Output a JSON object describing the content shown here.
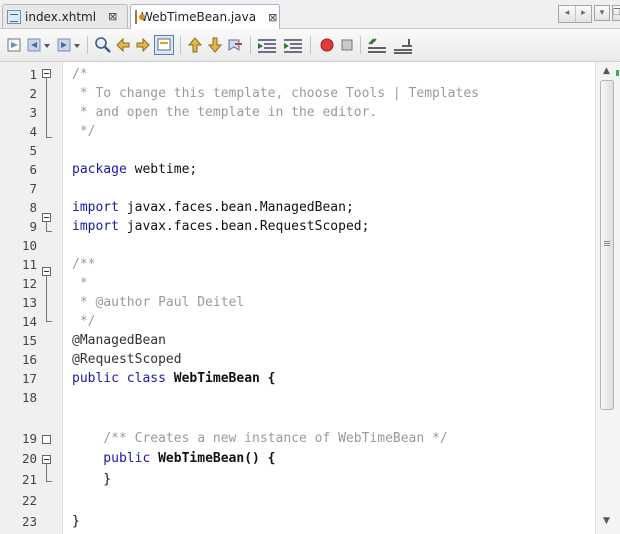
{
  "tabs": [
    {
      "label": "index.xhtml",
      "icon": "xhtml-file-icon",
      "close": "⊠",
      "active": false
    },
    {
      "label": "WebTimeBean.java",
      "icon": "java-file-icon",
      "close": "⊠",
      "active": true
    }
  ],
  "nav": {
    "left": "◂",
    "right": "▸",
    "dropdown": "▾",
    "restore": "❐"
  },
  "toolbar_icons": [
    "last-edit-icon",
    "back-icon",
    "forward-icon",
    "find-icon",
    "find-previous-icon",
    "find-next-icon",
    "toggle-highlight-icon",
    "previous-bookmark-icon",
    "next-bookmark-icon",
    "toggle-bookmark-icon",
    "shift-left-icon",
    "shift-right-icon",
    "start-macro-icon",
    "stop-macro-icon",
    "comment-icon",
    "uncomment-icon"
  ],
  "lines": [
    {
      "n": "1",
      "text": "/*",
      "cls": "c-comment"
    },
    {
      "n": "2",
      "text": " * To change this template, choose Tools | Templates",
      "cls": "c-comment"
    },
    {
      "n": "3",
      "text": " * and open the template in the editor.",
      "cls": "c-comment"
    },
    {
      "n": "4",
      "text": " */",
      "cls": "c-comment"
    },
    {
      "n": "5",
      "text": "",
      "cls": "c-plain"
    },
    {
      "n": "6",
      "kw": "package",
      "rest": " webtime;"
    },
    {
      "n": "7",
      "text": "",
      "cls": "c-plain"
    },
    {
      "n": "8",
      "kw": "import",
      "rest": " javax.faces.bean.ManagedBean;"
    },
    {
      "n": "9",
      "kw": "import",
      "rest": " javax.faces.bean.RequestScoped;"
    },
    {
      "n": "10",
      "text": "",
      "cls": "c-plain"
    },
    {
      "n": "11",
      "text": "/**",
      "cls": "c-comment"
    },
    {
      "n": "12",
      "text": " *",
      "cls": "c-comment"
    },
    {
      "n": "13",
      "text": " * @author Paul Deitel",
      "cls": "c-comment"
    },
    {
      "n": "14",
      "text": " */",
      "cls": "c-comment"
    },
    {
      "n": "15",
      "text": "@ManagedBean",
      "cls": "c-ann"
    },
    {
      "n": "16",
      "text": "@RequestScoped",
      "cls": "c-ann"
    },
    {
      "n": "17",
      "kw": "public class",
      "rest": " WebTimeBean {",
      "boldrest": true
    },
    {
      "n": "18",
      "text": "",
      "cls": "c-plain"
    },
    {
      "n": "19",
      "text": "    /** Creates a new instance of WebTimeBean */",
      "cls": "c-comment"
    },
    {
      "n": "20",
      "kw": "    public",
      "rest": " WebTimeBean() {",
      "boldrest": true
    },
    {
      "n": "21",
      "text": "    }",
      "cls": "c-plain"
    },
    {
      "n": "22",
      "text": "",
      "cls": "c-plain"
    },
    {
      "n": "23",
      "text": "}",
      "cls": "c-plain"
    }
  ]
}
